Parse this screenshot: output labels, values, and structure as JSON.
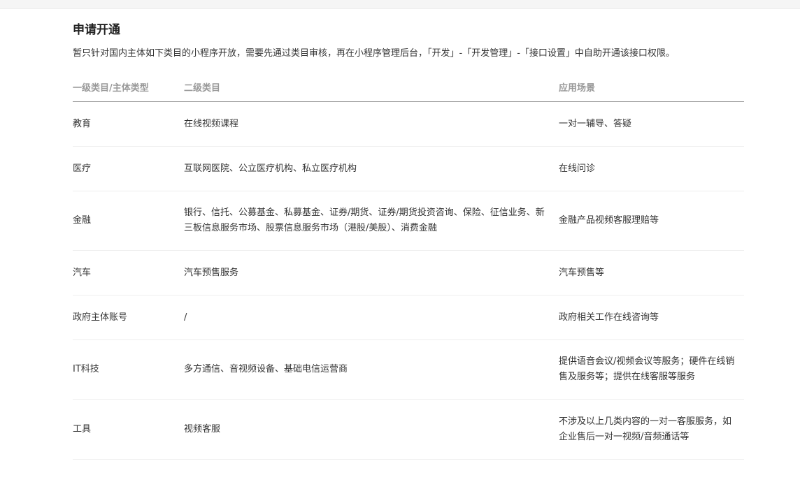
{
  "section": {
    "title": "申请开通",
    "description": "暂只针对国内主体如下类目的小程序开放，需要先通过类目审核，再在小程序管理后台，「开发」-「开发管理」-「接口设置」中自助开通该接口权限。"
  },
  "table": {
    "headers": [
      "一级类目/主体类型",
      "二级类目",
      "应用场景"
    ],
    "rows": [
      {
        "primary": "教育",
        "secondary": "在线视频课程",
        "scenario": "一对一辅导、答疑"
      },
      {
        "primary": "医疗",
        "secondary": "互联网医院、公立医疗机构、私立医疗机构",
        "scenario": "在线问诊"
      },
      {
        "primary": "金融",
        "secondary": "银行、信托、公募基金、私募基金、证券/期货、证券/期货投资咨询、保险、征信业务、新三板信息服务市场、股票信息服务市场（港股/美股）、消费金融",
        "scenario": "金融产品视频客服理赔等"
      },
      {
        "primary": "汽车",
        "secondary": "汽车预售服务",
        "scenario": "汽车预售等"
      },
      {
        "primary": "政府主体账号",
        "secondary": "/",
        "scenario": "政府相关工作在线咨询等"
      },
      {
        "primary": "IT科技",
        "secondary": "多方通信、音视频设备、基础电信运营商",
        "scenario": "提供语音会议/视频会议等服务；硬件在线销售及服务等；提供在线客服等服务"
      },
      {
        "primary": "工具",
        "secondary": "视频客服",
        "scenario": "不涉及以上几类内容的一对一客服服务，如企业售后一对一视频/音频通话等"
      }
    ]
  }
}
